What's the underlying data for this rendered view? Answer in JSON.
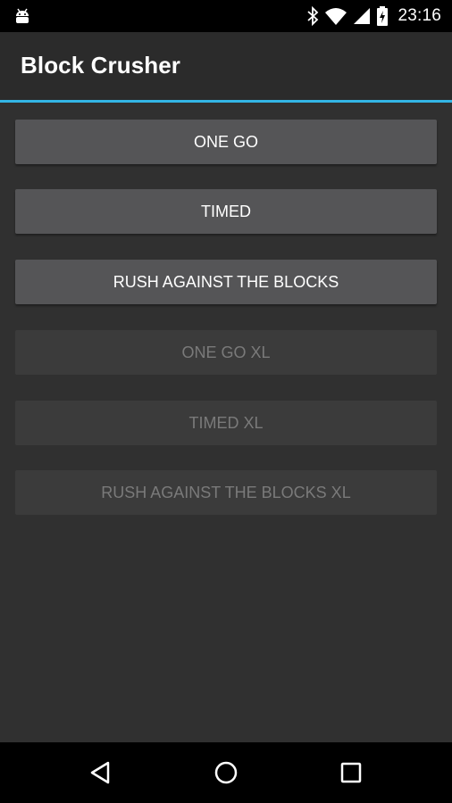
{
  "status_bar": {
    "time": "23:16",
    "icons": [
      "android-debug-icon",
      "bluetooth-icon",
      "wifi-icon",
      "signal-icon",
      "battery-charging-icon"
    ]
  },
  "action_bar": {
    "title": "Block Crusher",
    "accent_color": "#33b5e5"
  },
  "menu": {
    "buttons": [
      {
        "label": "ONE GO",
        "enabled": true
      },
      {
        "label": "TIMED",
        "enabled": true
      },
      {
        "label": "RUSH AGAINST THE BLOCKS",
        "enabled": true
      },
      {
        "label": "ONE GO XL",
        "enabled": false
      },
      {
        "label": "TIMED XL",
        "enabled": false
      },
      {
        "label": "RUSH AGAINST THE BLOCKS XL",
        "enabled": false
      }
    ]
  },
  "nav_bar": {
    "icons": [
      "back-icon",
      "home-icon",
      "recents-icon"
    ]
  }
}
